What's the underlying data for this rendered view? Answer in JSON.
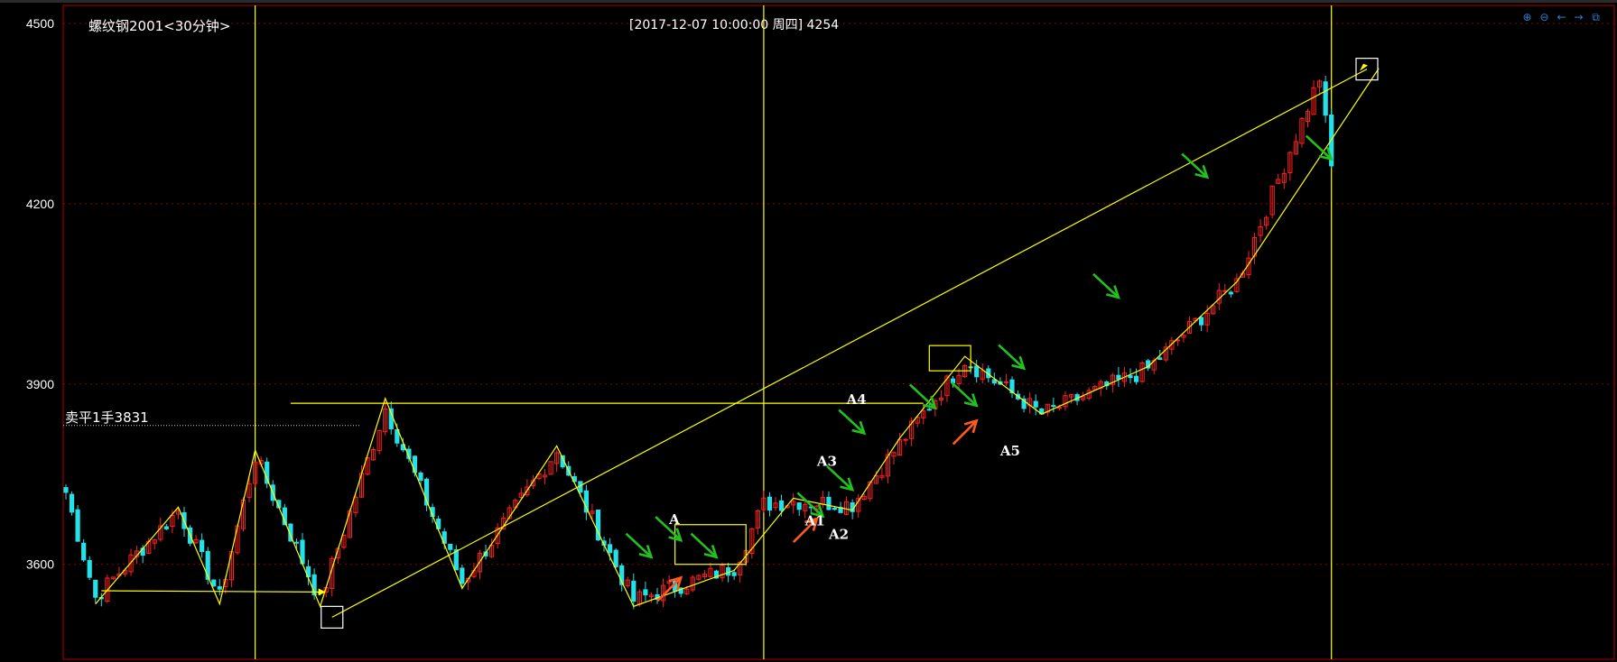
{
  "chart_data": {
    "type": "candlestick",
    "title": "螺纹钢2001<30分钟>",
    "cursor_info": "[2017-12-07  10:00:00 周四]    4254",
    "y_ticks": [
      4500,
      4200,
      3900,
      3600
    ],
    "ylim": [
      3442,
      4530
    ],
    "grid": "dotted-horizontal",
    "order_line": {
      "label": "卖平1手3831",
      "value": 3831
    },
    "colors": {
      "up": "#ff2020",
      "down": "#22e1e8",
      "line": "#ffff00",
      "green_arrow": "#22c21e",
      "orange_arrow": "#ff5a1f",
      "border": "#b00000"
    },
    "zigzag_points": [
      [
        5,
        3534
      ],
      [
        19,
        3695
      ],
      [
        26,
        3534
      ],
      [
        32,
        3790
      ],
      [
        43,
        3530
      ],
      [
        54,
        3876
      ],
      [
        67,
        3560
      ],
      [
        83,
        3797
      ],
      [
        96,
        3530
      ],
      [
        113,
        3590
      ],
      [
        123,
        3710
      ],
      [
        133,
        3690
      ],
      [
        141,
        3810
      ],
      [
        152,
        3946
      ],
      [
        165,
        3850
      ],
      [
        183,
        3929
      ],
      [
        198,
        4070
      ],
      [
        222,
        4425
      ]
    ],
    "trend_line": [
      [
        45,
        3512
      ],
      [
        220,
        4424
      ]
    ],
    "support_lines": [
      [
        [
          6,
          3556
        ],
        [
          43,
          3554
        ]
      ],
      [
        [
          38,
          3868
        ],
        [
          145,
          3868
        ]
      ]
    ],
    "boxes": [
      {
        "x0": 103,
        "x1": 115,
        "y0": 3600,
        "y1": 3666
      },
      {
        "x0": 146,
        "x1": 153,
        "y0": 3922,
        "y1": 3964
      }
    ],
    "markers": [
      {
        "label": "A",
        "x": 102,
        "y": 3667
      },
      {
        "label": "A1",
        "x": 125,
        "y": 3665
      },
      {
        "label": "A2",
        "x": 129,
        "y": 3642
      },
      {
        "label": "A3",
        "x": 127,
        "y": 3764
      },
      {
        "label": "A4",
        "x": 132,
        "y": 3867
      },
      {
        "label": "A5",
        "x": 158,
        "y": 3781
      }
    ],
    "green_arrows": [
      [
        99,
        3612
      ],
      [
        104,
        3640
      ],
      [
        110,
        3612
      ],
      [
        128,
        3680
      ],
      [
        133,
        3724
      ],
      [
        135,
        3818
      ],
      [
        147,
        3860
      ],
      [
        154,
        3864
      ],
      [
        162,
        3926
      ],
      [
        178,
        4044
      ],
      [
        193,
        4244
      ],
      [
        214,
        4274
      ]
    ],
    "orange_arrows": [
      [
        104,
        3578
      ],
      [
        127,
        3676
      ],
      [
        154,
        3839
      ]
    ],
    "vlines": [
      32,
      118,
      214
    ],
    "white_squares": [
      [
        45,
        3512
      ],
      [
        220,
        4424
      ]
    ],
    "candles": {
      "count": 215,
      "bar_spacing": 6.55,
      "closes_at_pivots": [
        [
          0,
          3720
        ],
        [
          5,
          3545
        ],
        [
          19,
          3690
        ],
        [
          26,
          3545
        ],
        [
          32,
          3780
        ],
        [
          43,
          3540
        ],
        [
          54,
          3860
        ],
        [
          67,
          3570
        ],
        [
          83,
          3790
        ],
        [
          96,
          3540
        ],
        [
          113,
          3595
        ],
        [
          118,
          3700
        ],
        [
          123,
          3705
        ],
        [
          133,
          3700
        ],
        [
          141,
          3800
        ],
        [
          152,
          3940
        ],
        [
          165,
          3850
        ],
        [
          183,
          3925
        ],
        [
          198,
          4070
        ],
        [
          212,
          4410
        ],
        [
          214,
          4260
        ]
      ]
    }
  },
  "toolbar": {
    "icons": [
      "zoom-in-icon",
      "zoom-out-icon",
      "arrow-left-icon",
      "arrow-right-icon",
      "restore-icon"
    ],
    "glyphs": [
      "⊕",
      "⊖",
      "←",
      "→",
      "⧉"
    ]
  }
}
